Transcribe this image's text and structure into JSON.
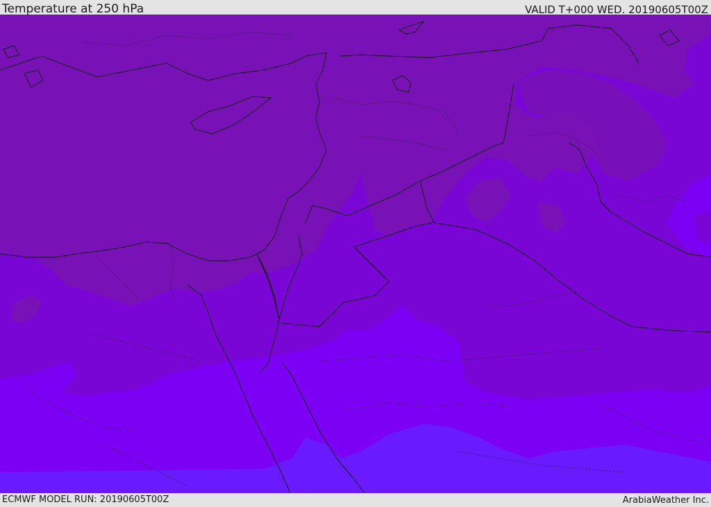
{
  "header": {
    "title": "Temperature at 250 hPa",
    "valid": "VALID T+000 WED. 20190605T00Z"
  },
  "footer": {
    "model_run": "ECMWF MODEL RUN: 20190605T00Z",
    "brand": "ArabiaWeather Inc."
  },
  "map": {
    "field": "temperature",
    "level": "250 hPa",
    "colors": {
      "band_warmest": "#7812b6",
      "band_warm": "#7a06d6",
      "band_mid": "#7c00f4",
      "band_cool": "#6a1aff",
      "coast_border": "#111111"
    }
  }
}
